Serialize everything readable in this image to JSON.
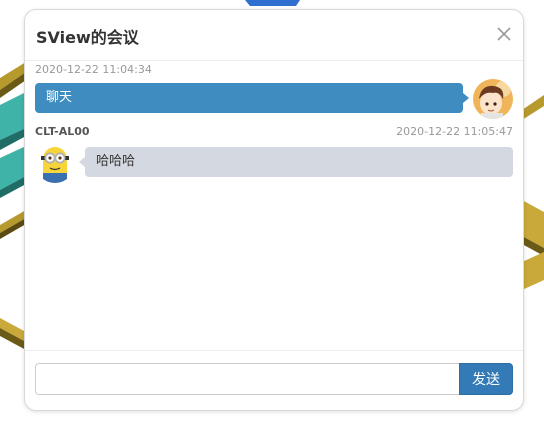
{
  "dialog": {
    "title": "SView的会议"
  },
  "messages": [
    {
      "side": "me",
      "time": "2020-12-22 11:04:34",
      "text": "聊天"
    },
    {
      "side": "them",
      "sender": "CLT-AL00",
      "time": "2020-12-22 11:05:47",
      "text": "哈哈哈"
    }
  ],
  "composer": {
    "value": "",
    "placeholder": "",
    "send_label": "发送"
  },
  "colors": {
    "my_bubble": "#3e8cc0",
    "their_bubble": "#d4d8e0",
    "send_button": "#337ab7"
  },
  "icons": {
    "close": "close-icon",
    "my_avatar": "anime-boy-avatar",
    "their_avatar": "minion-avatar"
  }
}
